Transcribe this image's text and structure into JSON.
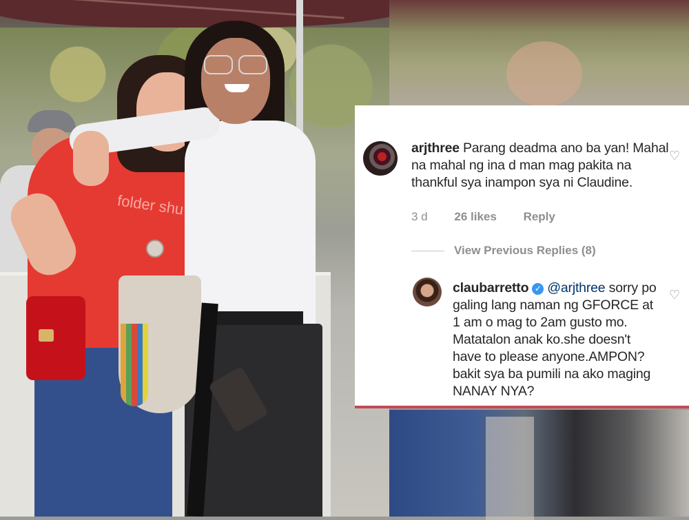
{
  "comments": [
    {
      "username": "arjthree",
      "text": "Parang deadma ano ba yan! Mahal na mahal ng ina d man mag pakita na thankful sya inampon sya ni Claudine.",
      "age": "3 d",
      "likes": "26 likes",
      "reply_label": "Reply"
    },
    {
      "username": "claubarretto",
      "mention": "@arjthree",
      "text": "sorry po galing lang naman ng GFORCE at 1 am o mag to 2am gusto mo. Matatalon anak ko.she doesn't have to please anyone.AMPON? bakit sya ba pumili na ako maging NANAY NYA?"
    }
  ],
  "view_previous_replies": "View Previous Replies (8)",
  "photo": {
    "shirt_text": "folder shu"
  },
  "icons": {
    "heart": "heart-outline-icon",
    "verified": "verified-badge-icon"
  },
  "colors": {
    "verified_blue": "#3897f0",
    "mention_blue": "#003569",
    "meta_gray": "#8e8e8e"
  }
}
